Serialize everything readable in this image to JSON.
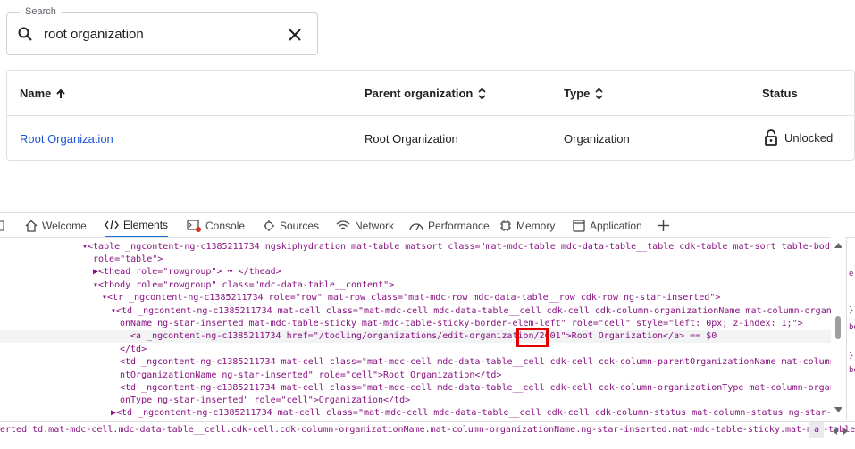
{
  "search": {
    "label": "Search",
    "value": "root organization"
  },
  "table": {
    "headers": [
      "Name",
      "Parent organization",
      "Type",
      "Status"
    ],
    "row": {
      "name": "Root Organization",
      "parent": "Root Organization",
      "type": "Organization",
      "status": "Unlocked"
    }
  },
  "devtools": {
    "tabs": [
      "Welcome",
      "Elements",
      "Console",
      "Sources",
      "Network",
      "Performance",
      "Memory",
      "Application"
    ],
    "active_tab": "Elements",
    "code_lines": [
      "▾<table _ngcontent-ng-c1385211734 ngskiphydration mat-table matsort class=\"mat-mdc-table mdc-data-table__table cdk-table mat-sort table-body\"",
      "role=\"table\">",
      "▶<thead role=\"rowgroup\"> ⋯ </thead>",
      "▾<tbody role=\"rowgroup\" class=\"mdc-data-table__content\">",
      "▾<tr _ngcontent-ng-c1385211734 role=\"row\" mat-row class=\"mat-mdc-row mdc-data-table__row cdk-row ng-star-inserted\">",
      "▾<td _ngcontent-ng-c1385211734 mat-cell class=\"mat-mdc-cell mdc-data-table__cell cdk-cell cdk-column-organizationName mat-column-organizati",
      "onName ng-star-inserted mat-mdc-table-sticky mat-mdc-table-sticky-border-elem-left\" role=\"cell\" style=\"left: 0px; z-index: 1;\">",
      "<a _ngcontent-ng-c1385211734 href=\"/tooling/organizations/edit-organization/2001\">Root Organization</a> == $0",
      "</td>",
      "<td _ngcontent-ng-c1385211734 mat-cell class=\"mat-mdc-cell mdc-data-table__cell cdk-cell cdk-column-parentOrganizationName mat-column-paren",
      "ntOrganizationName ng-star-inserted\" role=\"cell\">Root Organization</td>",
      "<td _ngcontent-ng-c1385211734 mat-cell class=\"mat-mdc-cell mdc-data-table__cell cdk-cell cdk-column-organizationType mat-column-organizati",
      "onType ng-star-inserted\" role=\"cell\">Organization</td>",
      "▶<td _ngcontent-ng-c1385211734 mat-cell class=\"mat-mdc-cell mdc-data-table__cell cdk-cell cdk-column-status mat-column-status ng-star-inser"
    ],
    "breadcrumb": "erted   td.mat-mdc-cell.mdc-data-table__cell.cdk-cell.cdk-column-organizationName.mat-column-organizationName.ng-star-inserted.mat-mdc-table-sticky.mat-mdc-table-sticky-border-elem-left",
    "breadcrumb_end": "a",
    "side_snippets": [
      "e:",
      "}",
      "bo",
      "}",
      "bo"
    ]
  }
}
